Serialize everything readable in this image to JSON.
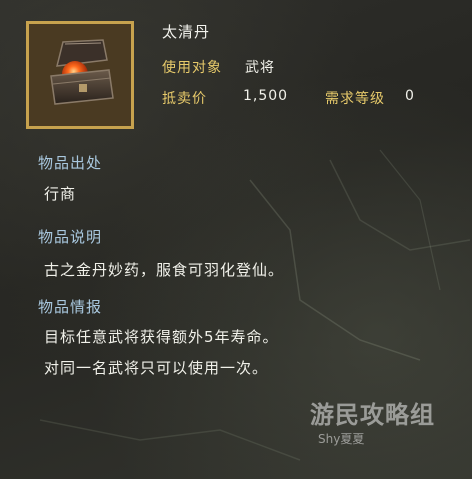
{
  "item": {
    "name": "太清丹",
    "user_label": "使用对象",
    "user_value": "武将",
    "price_label": "抵卖价",
    "price_value": "1,500",
    "level_label": "需求等级",
    "level_value": "0"
  },
  "sections": {
    "source_title": "物品出处",
    "source_text": "行商",
    "desc_title": "物品说明",
    "desc_text": "古之金丹妙药，服食可羽化登仙。",
    "info_title": "物品情报",
    "info_line1": "目标任意武将获得额外5年寿命。",
    "info_line2": "对同一名武将只可以使用一次。"
  },
  "watermark": {
    "site": "游民攻略组",
    "author": "Shy夏夏"
  },
  "colors": {
    "gold_label": "#e6c96a",
    "section_title": "#a9c8df",
    "frame_gold": "#c7a24e"
  },
  "icons": [
    "treasure-chest-icon"
  ]
}
